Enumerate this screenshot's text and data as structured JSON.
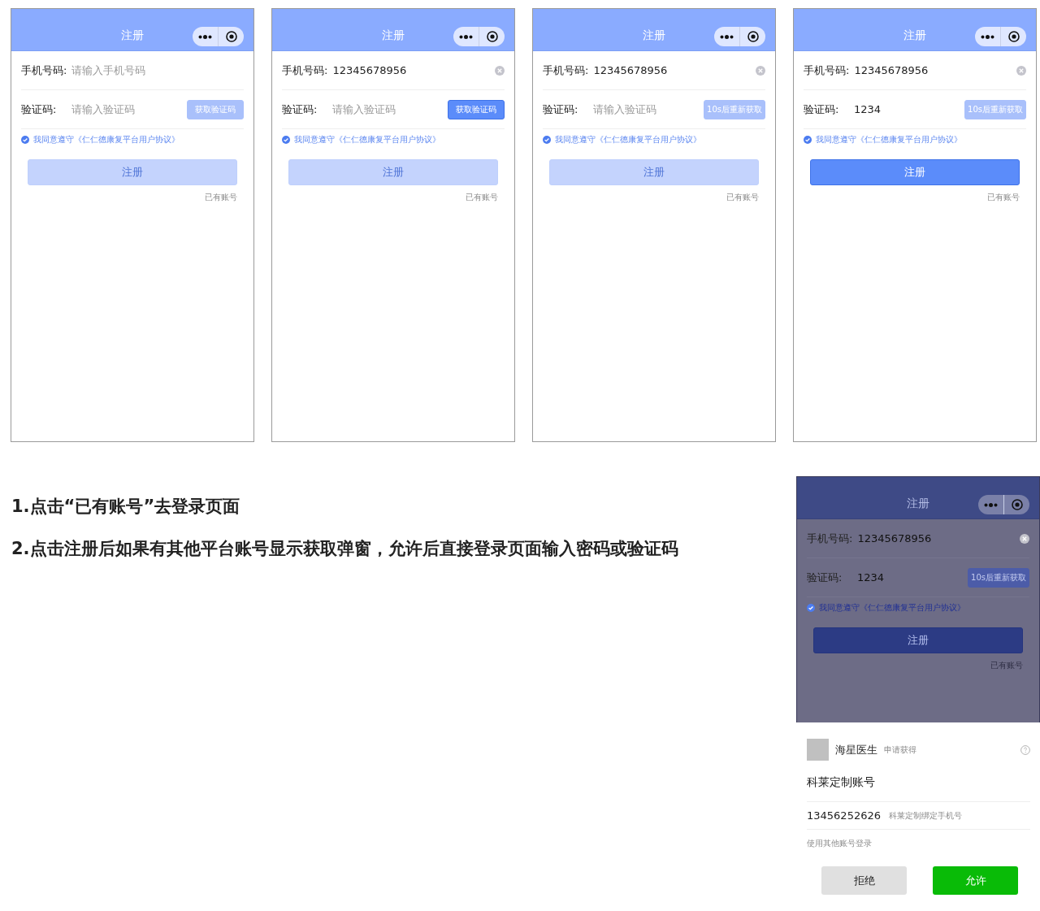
{
  "screens": [
    {
      "title": "注册",
      "phone": {
        "label": "手机号码:",
        "placeholder": "请输入手机号码",
        "clear_button": false
      },
      "code": {
        "label": "验证码:",
        "placeholder": "请输入验证码"
      },
      "code_button": {
        "label": "获取验证码",
        "disabled": true
      },
      "agreement": {
        "text": "我同意遵守《仁仁德康复平台用户协议》",
        "checked": true
      },
      "submit": {
        "label": "注册",
        "disabled": true
      },
      "login_link": "已有账号"
    },
    {
      "title": "注册",
      "phone": {
        "label": "手机号码:",
        "value": "12345678956",
        "clear_button": true
      },
      "code": {
        "label": "验证码:",
        "placeholder": "请输入验证码"
      },
      "code_button": {
        "label": "获取验证码",
        "disabled": false
      },
      "agreement": {
        "text": "我同意遵守《仁仁德康复平台用户协议》",
        "checked": true
      },
      "submit": {
        "label": "注册",
        "disabled": true
      },
      "login_link": "已有账号"
    },
    {
      "title": "注册",
      "phone": {
        "label": "手机号码:",
        "value": "12345678956",
        "clear_button": true
      },
      "code": {
        "label": "验证码:",
        "placeholder": "请输入验证码"
      },
      "code_button": {
        "label": "10s后重新获取",
        "disabled": true
      },
      "agreement": {
        "text": "我同意遵守《仁仁德康复平台用户协议》",
        "checked": true
      },
      "submit": {
        "label": "注册",
        "disabled": true
      },
      "login_link": "已有账号"
    },
    {
      "title": "注册",
      "phone": {
        "label": "手机号码:",
        "value": "12345678956",
        "clear_button": true
      },
      "code": {
        "label": "验证码:",
        "value": "1234"
      },
      "code_button": {
        "label": "10s后重新获取",
        "disabled": true
      },
      "agreement": {
        "text": "我同意遵守《仁仁德康复平台用户协议》",
        "checked": true
      },
      "submit": {
        "label": "注册",
        "disabled": false
      },
      "login_link": "已有账号"
    }
  ],
  "notes": [
    "1.点击“已有账号”去登录页面",
    "2.点击注册后如果有其他平台账号显示获取弹窗，允许后直接登录页面输入密码或验证码"
  ],
  "dialog_screen": {
    "dimmed": true,
    "title": "注册",
    "phone": {
      "label": "手机号码:",
      "value": "12345678956",
      "clear_button": true
    },
    "code": {
      "label": "验证码:",
      "value": "1234"
    },
    "code_button": {
      "label": "10s后重新获取",
      "disabled": true
    },
    "agreement": {
      "text": "我同意遵守《仁仁德康复平台用户协议》",
      "checked": true
    },
    "submit": {
      "label": "注册",
      "disabled": false
    },
    "login_link": "已有账号"
  },
  "dialog": {
    "app_name": "海星医生",
    "request": "申请获得",
    "scope": "科莱定制账号",
    "account": {
      "phone": "13456252626",
      "note": "科莱定制绑定手机号"
    },
    "other_login": "使用其他账号登录",
    "buttons": [
      {
        "label": "拒绝",
        "kind": "secondary"
      },
      {
        "label": "允许",
        "kind": "primary"
      }
    ]
  }
}
